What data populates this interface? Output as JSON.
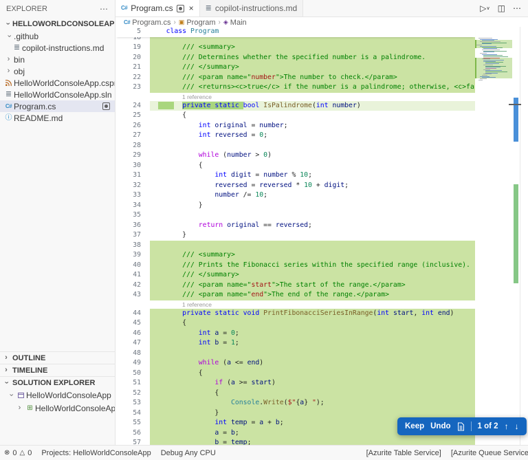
{
  "sidebar": {
    "title": "EXPLORER",
    "more": "⋯",
    "root": "HELLOWORLDCONSOLEAPP",
    "files": [
      {
        "label": ".github",
        "slot": "chev-open",
        "level": 1
      },
      {
        "label": "copilot-instructions.md",
        "slot": "md",
        "level": 2
      },
      {
        "label": "bin",
        "slot": "chev",
        "level": 1
      },
      {
        "label": "obj",
        "slot": "chev",
        "level": 1
      },
      {
        "label": "HelloWorldConsoleApp.csproj",
        "slot": "csproj",
        "level": 1
      },
      {
        "label": "HelloWorldConsoleApp.sln",
        "slot": "sln",
        "level": 1
      },
      {
        "label": "Program.cs",
        "slot": "cs",
        "level": 1,
        "selected": true,
        "badge": true
      },
      {
        "label": "README.md",
        "slot": "info",
        "level": 1
      }
    ],
    "sections": [
      {
        "label": "OUTLINE",
        "expanded": false
      },
      {
        "label": "TIMELINE",
        "expanded": false
      },
      {
        "label": "SOLUTION EXPLORER",
        "expanded": true
      }
    ],
    "solution": [
      {
        "label": "HelloWorldConsoleApp",
        "icon": "solution",
        "chev": "open",
        "level": 1
      },
      {
        "label": "HelloWorldConsoleApp",
        "icon": "project",
        "chev": "closed",
        "level": 2
      }
    ]
  },
  "tabs": [
    {
      "label": "Program.cs",
      "active": true,
      "modified_badge": true,
      "close": "×"
    },
    {
      "label": "copilot-instructions.md",
      "active": false
    }
  ],
  "editor_actions": {
    "run": "▷",
    "run_dd": "∨",
    "split": "◫",
    "more": "⋯"
  },
  "breadcrumb": [
    "Program.cs",
    "Program",
    "Main"
  ],
  "keep_widget": {
    "keep": "Keep",
    "undo": "Undo",
    "counter": "1 of 2",
    "up": "↑",
    "down": "↓"
  },
  "status_bar": {
    "error_icon": "⊗",
    "errors": "0",
    "warn_icon": "△",
    "warnings": "0",
    "projects": "Projects: HelloWorldConsoleApp",
    "config": "Debug Any CPU",
    "right": [
      "[Azurite Table Service]",
      "[Azurite Queue Service]"
    ]
  },
  "editor": {
    "sticky": {
      "n": "5",
      "t": [
        [
          "kw",
          "    class"
        ],
        [
          "pln",
          " "
        ],
        [
          "type",
          "Program"
        ]
      ]
    },
    "lines": [
      {
        "n": "18",
        "hl": "add",
        "partial": true,
        "t": [
          [
            "pln",
            ""
          ]
        ]
      },
      {
        "n": "19",
        "hl": "add",
        "t": [
          [
            "com",
            "        /// <summary>"
          ]
        ]
      },
      {
        "n": "20",
        "hl": "add",
        "t": [
          [
            "com",
            "        /// Determines whether the specified number is a palindrome."
          ]
        ]
      },
      {
        "n": "21",
        "hl": "add",
        "t": [
          [
            "com",
            "        /// </summary>"
          ]
        ]
      },
      {
        "n": "22",
        "hl": "add",
        "t": [
          [
            "com",
            "        /// <param name=\""
          ],
          [
            "str",
            "number"
          ],
          [
            "com",
            "\">The number to check.</param>"
          ]
        ]
      },
      {
        "n": "23",
        "hl": "add",
        "t": [
          [
            "com",
            "        /// <returns><c>true</c> if the number is a palindrome; otherwise, <c>fa"
          ]
        ]
      },
      {
        "lens": "1 reference"
      },
      {
        "n": "24",
        "hl": "light",
        "t": [
          [
            "pln",
            "  "
          ],
          [
            "pln",
            "    ",
            1
          ],
          [
            "pln",
            "  "
          ],
          [
            "kw",
            "private static ",
            1
          ],
          [
            "kw",
            "bool "
          ],
          [
            "fn",
            "IsPalindrome"
          ],
          [
            "pln",
            "("
          ],
          [
            "kw",
            "int"
          ],
          [
            "pln",
            " "
          ],
          [
            "var",
            "number"
          ],
          [
            "pln",
            ")"
          ]
        ]
      },
      {
        "n": "25",
        "t": [
          [
            "pln",
            "        {"
          ]
        ]
      },
      {
        "n": "26",
        "t": [
          [
            "kw",
            "            int"
          ],
          [
            "pln",
            " "
          ],
          [
            "var",
            "original"
          ],
          [
            "pln",
            " = "
          ],
          [
            "var",
            "number"
          ],
          [
            "pln",
            ";"
          ]
        ]
      },
      {
        "n": "27",
        "t": [
          [
            "kw",
            "            int"
          ],
          [
            "pln",
            " "
          ],
          [
            "var",
            "reversed"
          ],
          [
            "pln",
            " = "
          ],
          [
            "num",
            "0"
          ],
          [
            "pln",
            ";"
          ]
        ]
      },
      {
        "n": "28",
        "t": [
          [
            "pln",
            ""
          ]
        ]
      },
      {
        "n": "29",
        "t": [
          [
            "ctrl",
            "            while"
          ],
          [
            "pln",
            " ("
          ],
          [
            "var",
            "number"
          ],
          [
            "pln",
            " > "
          ],
          [
            "num",
            "0"
          ],
          [
            "pln",
            ")"
          ]
        ]
      },
      {
        "n": "30",
        "t": [
          [
            "pln",
            "            {"
          ]
        ]
      },
      {
        "n": "31",
        "t": [
          [
            "kw",
            "                int"
          ],
          [
            "pln",
            " "
          ],
          [
            "var",
            "digit"
          ],
          [
            "pln",
            " = "
          ],
          [
            "var",
            "number"
          ],
          [
            "pln",
            " % "
          ],
          [
            "num",
            "10"
          ],
          [
            "pln",
            ";"
          ]
        ]
      },
      {
        "n": "32",
        "t": [
          [
            "pln",
            "                "
          ],
          [
            "var",
            "reversed"
          ],
          [
            "pln",
            " = "
          ],
          [
            "var",
            "reversed"
          ],
          [
            "pln",
            " * "
          ],
          [
            "num",
            "10"
          ],
          [
            "pln",
            " + "
          ],
          [
            "var",
            "digit"
          ],
          [
            "pln",
            ";"
          ]
        ]
      },
      {
        "n": "33",
        "t": [
          [
            "pln",
            "                "
          ],
          [
            "var",
            "number"
          ],
          [
            "pln",
            " /= "
          ],
          [
            "num",
            "10"
          ],
          [
            "pln",
            ";"
          ]
        ]
      },
      {
        "n": "34",
        "t": [
          [
            "pln",
            "            }"
          ]
        ]
      },
      {
        "n": "35",
        "t": [
          [
            "pln",
            ""
          ]
        ]
      },
      {
        "n": "36",
        "t": [
          [
            "ctrl",
            "            return"
          ],
          [
            "pln",
            " "
          ],
          [
            "var",
            "original"
          ],
          [
            "pln",
            " == "
          ],
          [
            "var",
            "reversed"
          ],
          [
            "pln",
            ";"
          ]
        ]
      },
      {
        "n": "37",
        "t": [
          [
            "pln",
            "        }"
          ]
        ]
      },
      {
        "n": "38",
        "hl": "add",
        "t": [
          [
            "pln",
            ""
          ]
        ]
      },
      {
        "n": "39",
        "hl": "add",
        "t": [
          [
            "com",
            "        /// <summary>"
          ]
        ]
      },
      {
        "n": "40",
        "hl": "add",
        "t": [
          [
            "com",
            "        /// Prints the Fibonacci series within the specified range (inclusive)."
          ]
        ]
      },
      {
        "n": "41",
        "hl": "add",
        "t": [
          [
            "com",
            "        /// </summary>"
          ]
        ]
      },
      {
        "n": "42",
        "hl": "add",
        "t": [
          [
            "com",
            "        /// <param name=\""
          ],
          [
            "str",
            "start"
          ],
          [
            "com",
            "\">The start of the range.</param>"
          ]
        ]
      },
      {
        "n": "43",
        "hl": "add",
        "t": [
          [
            "com",
            "        /// <param name=\""
          ],
          [
            "str",
            "end"
          ],
          [
            "com",
            "\">The end of the range.</param>"
          ]
        ]
      },
      {
        "lens": "1 reference"
      },
      {
        "n": "44",
        "hl": "add",
        "t": [
          [
            "kw",
            "        private static void "
          ],
          [
            "fn",
            "PrintFibonacciSeriesInRange"
          ],
          [
            "pln",
            "("
          ],
          [
            "kw",
            "int"
          ],
          [
            "pln",
            " "
          ],
          [
            "var",
            "start"
          ],
          [
            "pln",
            ", "
          ],
          [
            "kw",
            "int"
          ],
          [
            "pln",
            " "
          ],
          [
            "var",
            "end"
          ],
          [
            "pln",
            ")"
          ]
        ]
      },
      {
        "n": "45",
        "hl": "add",
        "t": [
          [
            "pln",
            "        {"
          ]
        ]
      },
      {
        "n": "46",
        "hl": "add",
        "t": [
          [
            "kw",
            "            int"
          ],
          [
            "pln",
            " "
          ],
          [
            "var",
            "a"
          ],
          [
            "pln",
            " = "
          ],
          [
            "num",
            "0"
          ],
          [
            "pln",
            ";"
          ]
        ]
      },
      {
        "n": "47",
        "hl": "add",
        "t": [
          [
            "kw",
            "            int"
          ],
          [
            "pln",
            " "
          ],
          [
            "var",
            "b"
          ],
          [
            "pln",
            " = "
          ],
          [
            "num",
            "1"
          ],
          [
            "pln",
            ";"
          ]
        ]
      },
      {
        "n": "48",
        "hl": "add",
        "t": [
          [
            "pln",
            ""
          ]
        ]
      },
      {
        "n": "49",
        "hl": "add",
        "t": [
          [
            "ctrl",
            "            while"
          ],
          [
            "pln",
            " ("
          ],
          [
            "var",
            "a"
          ],
          [
            "pln",
            " <= "
          ],
          [
            "var",
            "end"
          ],
          [
            "pln",
            ")"
          ]
        ]
      },
      {
        "n": "50",
        "hl": "add",
        "t": [
          [
            "pln",
            "            {"
          ]
        ]
      },
      {
        "n": "51",
        "hl": "add",
        "t": [
          [
            "ctrl",
            "                if"
          ],
          [
            "pln",
            " ("
          ],
          [
            "var",
            "a"
          ],
          [
            "pln",
            " >= "
          ],
          [
            "var",
            "start"
          ],
          [
            "pln",
            ")"
          ]
        ]
      },
      {
        "n": "52",
        "hl": "add",
        "t": [
          [
            "pln",
            "                {"
          ]
        ]
      },
      {
        "n": "53",
        "hl": "add",
        "t": [
          [
            "pln",
            "                    "
          ],
          [
            "type",
            "Console"
          ],
          [
            "pln",
            "."
          ],
          [
            "fn",
            "Write"
          ],
          [
            "pln",
            "("
          ],
          [
            "str",
            "$\""
          ],
          [
            "pln",
            "{"
          ],
          [
            "var",
            "a"
          ],
          [
            "pln",
            "}"
          ],
          [
            "str",
            " \""
          ],
          [
            "pln",
            ");"
          ]
        ]
      },
      {
        "n": "54",
        "hl": "add",
        "t": [
          [
            "pln",
            "                }"
          ]
        ]
      },
      {
        "n": "55",
        "hl": "add",
        "t": [
          [
            "kw",
            "                int"
          ],
          [
            "pln",
            " "
          ],
          [
            "var",
            "temp"
          ],
          [
            "pln",
            " = "
          ],
          [
            "var",
            "a"
          ],
          [
            "pln",
            " + "
          ],
          [
            "var",
            "b"
          ],
          [
            "pln",
            ";"
          ]
        ]
      },
      {
        "n": "56",
        "hl": "add",
        "t": [
          [
            "pln",
            "                "
          ],
          [
            "var",
            "a"
          ],
          [
            "pln",
            " = "
          ],
          [
            "var",
            "b"
          ],
          [
            "pln",
            ";"
          ]
        ]
      },
      {
        "n": "57",
        "hl": "add",
        "t": [
          [
            "pln",
            "                "
          ],
          [
            "var",
            "b"
          ],
          [
            "pln",
            " = "
          ],
          [
            "var",
            "temp"
          ],
          [
            "pln",
            ";"
          ]
        ]
      }
    ]
  }
}
